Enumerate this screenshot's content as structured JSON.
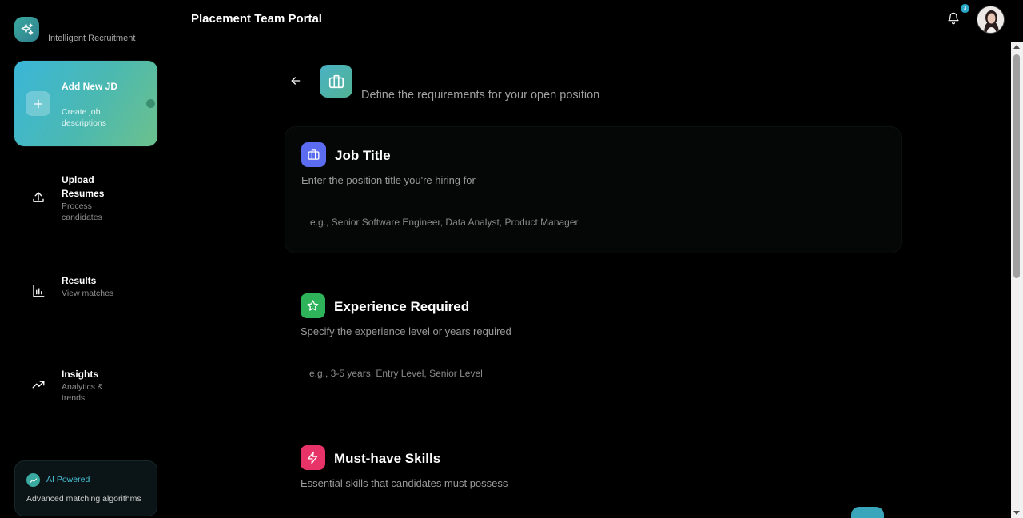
{
  "sidebar": {
    "logo_icon": "sparkle-icon",
    "tagline": "Intelligent Recruitment",
    "active_item": {
      "title": "Add New JD",
      "subtitle": "Create job descriptions",
      "icon": "plus-icon"
    },
    "items": [
      {
        "title": "Upload Resumes",
        "subtitle": "Process candidates",
        "icon": "upload-icon"
      },
      {
        "title": "Results",
        "subtitle": "View matches",
        "icon": "bar-chart-icon"
      },
      {
        "title": "Insights",
        "subtitle": "Analytics & trends",
        "icon": "trending-up-icon"
      }
    ],
    "ai_box": {
      "label": "AI Powered",
      "description": "Advanced matching algorithms"
    }
  },
  "header": {
    "title": "Placement Team Portal",
    "notification_count": "3"
  },
  "main": {
    "subtitle": "Define the requirements for your open position",
    "sections": [
      {
        "title": "Job Title",
        "description": "Enter the position title you're hiring for",
        "placeholder": "e.g., Senior Software Engineer, Data Analyst, Product Manager",
        "icon": "briefcase-icon",
        "color": "#5b6cf0"
      },
      {
        "title": "Experience Required",
        "description": "Specify the experience level or years required",
        "placeholder": "e.g., 3-5 years, Entry Level, Senior Level",
        "icon": "star-icon",
        "color": "#2fb35a"
      },
      {
        "title": "Must-have Skills",
        "description": "Essential skills that candidates must possess",
        "icon": "lightning-icon",
        "color": "#e83368"
      }
    ]
  },
  "colors": {
    "accent": "#3aa9a0",
    "accent_cyan": "#47c0d6"
  }
}
